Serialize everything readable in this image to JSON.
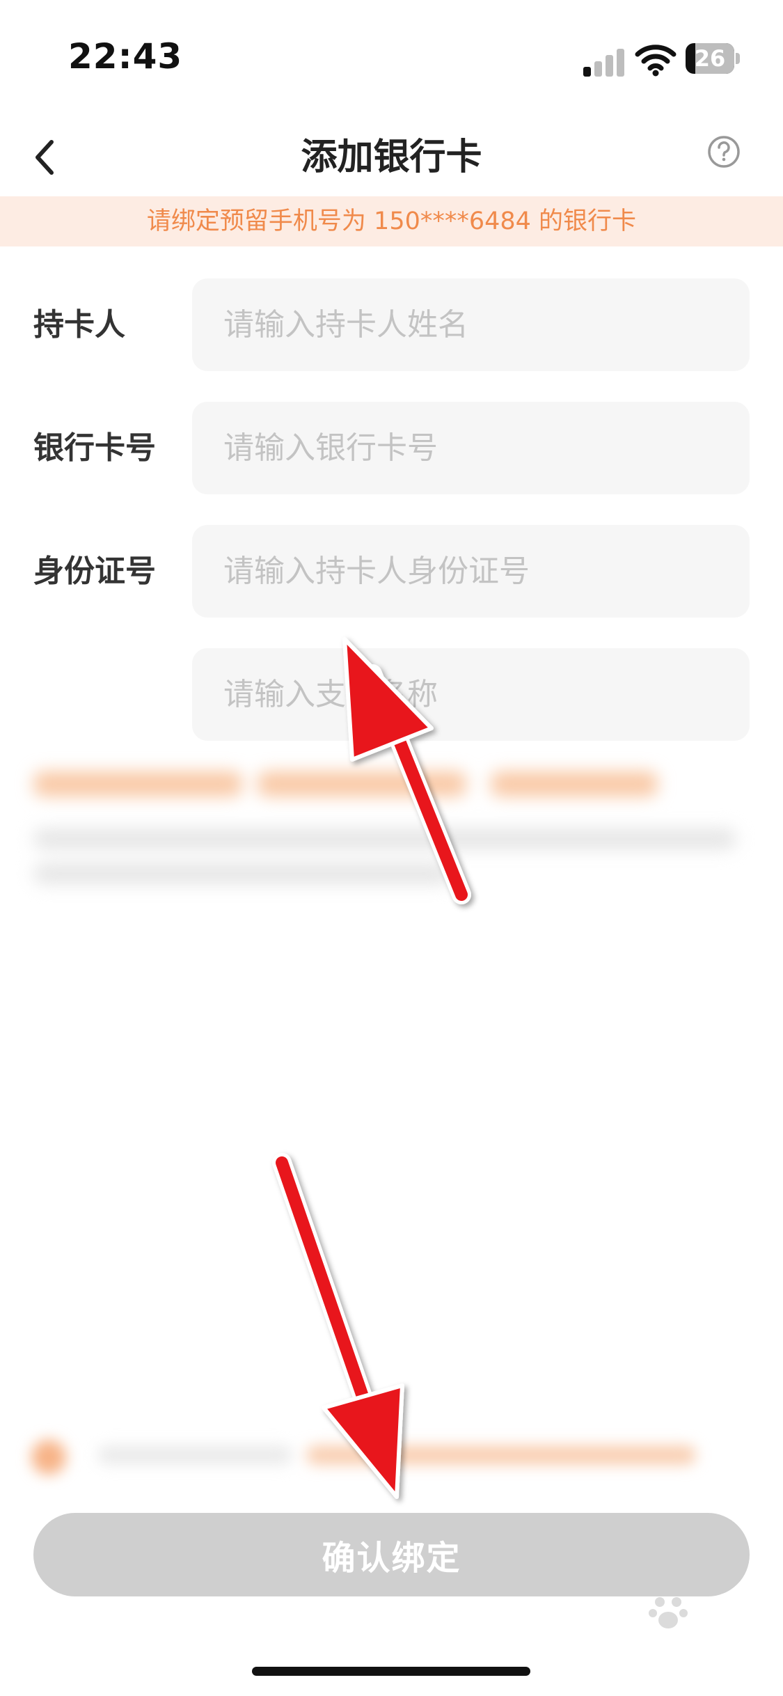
{
  "status_bar": {
    "time": "22:43",
    "battery": "26",
    "signal_icon": "signal-icon",
    "wifi_icon": "wifi-icon",
    "battery_icon": "battery-icon"
  },
  "nav": {
    "title": "添加银行卡",
    "back_icon": "chevron-left-icon",
    "help_icon": "question-circle-icon"
  },
  "notice": {
    "text": "请绑定预留手机号为 150****6484 的银行卡"
  },
  "form": {
    "holder": {
      "label": "持卡人",
      "value": "",
      "placeholder": "请输入持卡人姓名"
    },
    "card_number": {
      "label": "银行卡号",
      "value": "",
      "placeholder": "请输入银行卡号"
    },
    "id_number": {
      "label": "身份证号",
      "value": "",
      "placeholder": "请输入持卡人身份证号"
    },
    "branch": {
      "label": "",
      "value": "",
      "placeholder": "请输入支行名称"
    }
  },
  "footer": {
    "confirm_label": "确认绑定"
  },
  "colors": {
    "accent": "#f08a4b",
    "notice_bg": "#fdece3",
    "button_disabled": "#cfcfcf",
    "annotation_arrow": "#e8161b"
  }
}
